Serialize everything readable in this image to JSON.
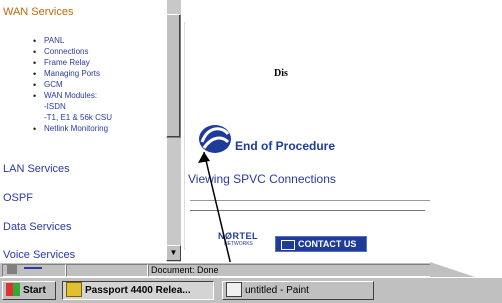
{
  "nav": {
    "wan": "WAN Services",
    "items": [
      "PANL",
      "Connections",
      "Frame Relay",
      "Managing Ports",
      "GCM",
      "WAN Modules:"
    ],
    "wan_modules_sub": [
      "-ISDN",
      "-T1, E1 & 56k CSU"
    ],
    "netlink": "Netlink Monitoring",
    "lan": "LAN Services",
    "ospf": "OSPF",
    "data": "Data Services",
    "voice": "Voice Services"
  },
  "content": {
    "heading": "Dis",
    "end_procedure": "End of Procedure",
    "link": "Viewing SPVC Connections",
    "logo_line1": "NØRTEL",
    "logo_line2": "NETWORKS",
    "contact": "CONTACT US"
  },
  "status": {
    "text": "Document: Done"
  },
  "taskbar": {
    "start": "Start",
    "tasks": [
      "Passport 4400 Relea...",
      "untitled - Paint"
    ]
  },
  "colors": {
    "link": "#2a3aa3",
    "accent": "#c06a0a",
    "nortel_blue": "#1f3b9a"
  }
}
